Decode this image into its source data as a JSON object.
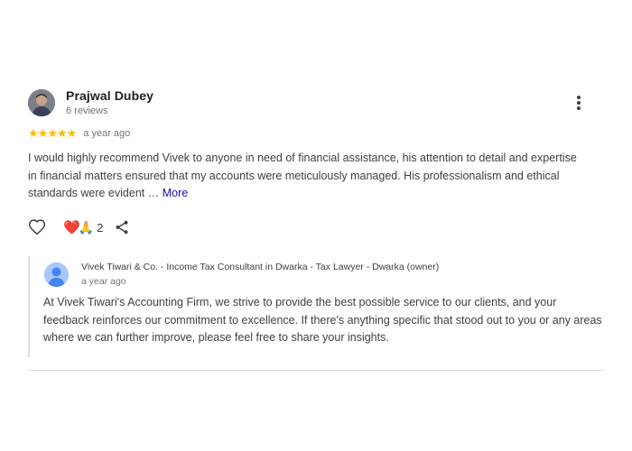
{
  "review": {
    "author": "Prajwal Dubey",
    "reviews_count": "6 reviews",
    "rating": 5,
    "stars": [
      "★",
      "★",
      "★",
      "★",
      "★"
    ],
    "time": "a year ago",
    "text": "I would highly recommend Vivek to anyone in need of financial assistance, his attention to detail and expertise in financial matters ensured that my accounts were meticulously managed. His professionalism and ethical standards were evident … ",
    "more_label": "More",
    "reactions": {
      "emoji": [
        "❤️",
        "🙏"
      ],
      "count": "2"
    },
    "icons": {
      "menu": "more-vert-icon",
      "like": "heart-outline-icon",
      "share": "share-icon"
    }
  },
  "owner_response": {
    "name": "Vivek Tiwari & Co. - Income Tax Consultant in Dwarka - Tax Lawyer - Dwarka (owner)",
    "time": "a year ago",
    "text": "At Vivek Tiwari's Accounting Firm, we strive to provide the best possible service to our clients, and your feedback reinforces our commitment to excellence. If there's anything specific that stood out to you or any areas where we can further improve, please feel free to share your insights."
  },
  "colors": {
    "star": "#fbbc04",
    "link": "#1a0dab",
    "owner_avatar": "#8ab4f8",
    "divider": "#dadce0"
  }
}
